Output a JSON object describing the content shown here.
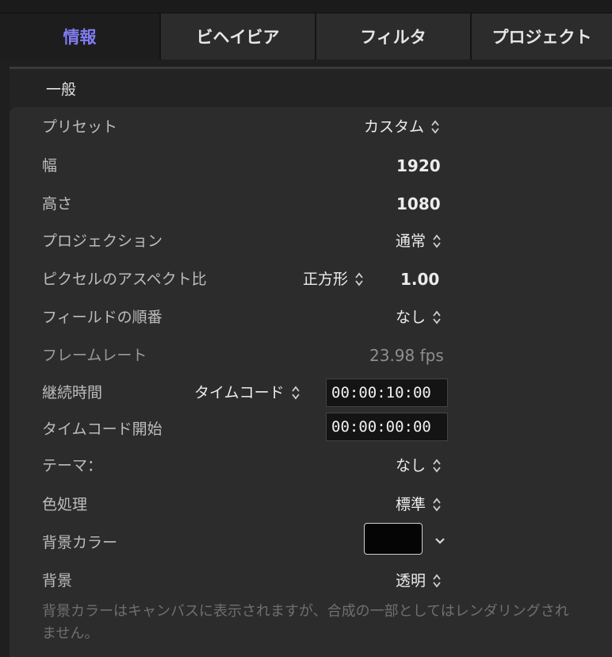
{
  "tabs": [
    {
      "label": "情報",
      "active": true
    },
    {
      "label": "ビヘイビア",
      "active": false
    },
    {
      "label": "フィルタ",
      "active": false
    },
    {
      "label": "プロジェクト",
      "active": false
    }
  ],
  "section": {
    "title": "一般"
  },
  "rows": {
    "preset": {
      "label": "プリセット",
      "value": "カスタム"
    },
    "width": {
      "label": "幅",
      "value": "1920"
    },
    "height": {
      "label": "高さ",
      "value": "1080"
    },
    "projection": {
      "label": "プロジェクション",
      "value": "通常"
    },
    "pixel_aspect": {
      "label": "ピクセルのアスペクト比",
      "popup": "正方形",
      "value": "1.00"
    },
    "field_order": {
      "label": "フィールドの順番",
      "value": "なし"
    },
    "frame_rate": {
      "label": "フレームレート",
      "value": "23.98 fps"
    },
    "duration": {
      "label": "継続時間",
      "popup": "タイムコード",
      "value": "00:00:10:00"
    },
    "timecode_start": {
      "label": "タイムコード開始",
      "value": "00:00:00:00"
    },
    "theme": {
      "label": "テーマ：",
      "value": "なし"
    },
    "color_processing": {
      "label": "色処理",
      "value": "標準"
    },
    "background_color": {
      "label": "背景カラー",
      "swatch_color": "#050505"
    },
    "background": {
      "label": "背景",
      "value": "透明"
    }
  },
  "note": "背景カラーはキャンバスに表示されますが、合成の一部としてはレンダリングされません。",
  "colors": {
    "accent": "#7f7cf0",
    "panel": "#2c2c2c",
    "background": "#1f1f1f"
  }
}
